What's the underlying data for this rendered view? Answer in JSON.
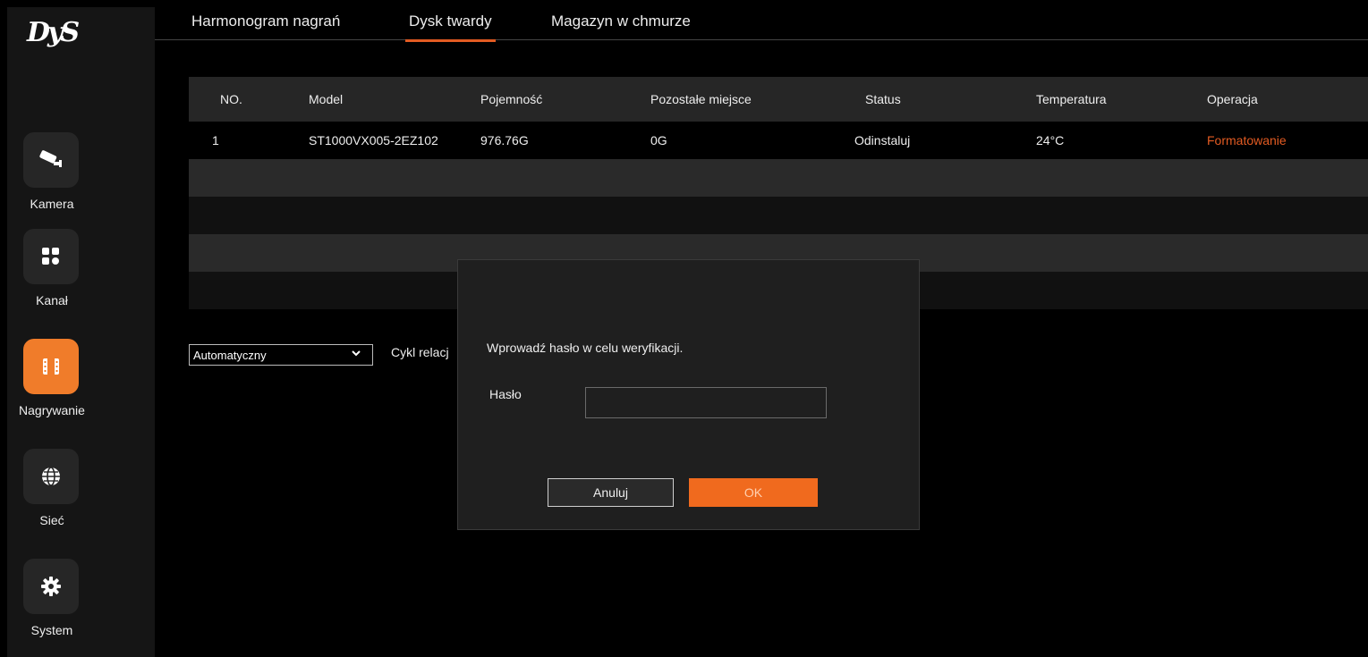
{
  "logo": {
    "text": "DyS"
  },
  "sidebar": {
    "items": [
      {
        "label": "Kamera",
        "icon": "camera-icon"
      },
      {
        "label": "Kanał",
        "icon": "grid-icon"
      },
      {
        "label": "Nagrywanie",
        "icon": "film-icon",
        "active": true
      },
      {
        "label": "Sieć",
        "icon": "globe-icon"
      },
      {
        "label": "System",
        "icon": "gear-icon"
      }
    ]
  },
  "tabs": [
    {
      "label": "Harmonogram nagrań"
    },
    {
      "label": "Dysk twardy",
      "active": true
    },
    {
      "label": "Magazyn w chmurze"
    }
  ],
  "table": {
    "headers": [
      "NO.",
      "Model",
      "Pojemność",
      "Pozostałe miejsce",
      "Status",
      "Temperatura",
      "Operacja"
    ],
    "rows": [
      [
        "1",
        "ST1000VX005-2EZ102",
        "976.76G",
        "0G",
        "Odinstaluj",
        "24°C",
        "Formatowanie"
      ]
    ]
  },
  "controls": {
    "mode_select": "Automatyczny",
    "cycle_label": "Cykl relacj"
  },
  "dialog": {
    "message": "Wprowadź hasło w celu weryfikacji.",
    "password_label": "Hasło",
    "password_value": "",
    "cancel_label": "Anuluj",
    "ok_label": "OK"
  },
  "colors": {
    "accent": "#f06a1e",
    "sidebar_bg": "#151515",
    "dialog_bg": "#1f1f1f"
  }
}
